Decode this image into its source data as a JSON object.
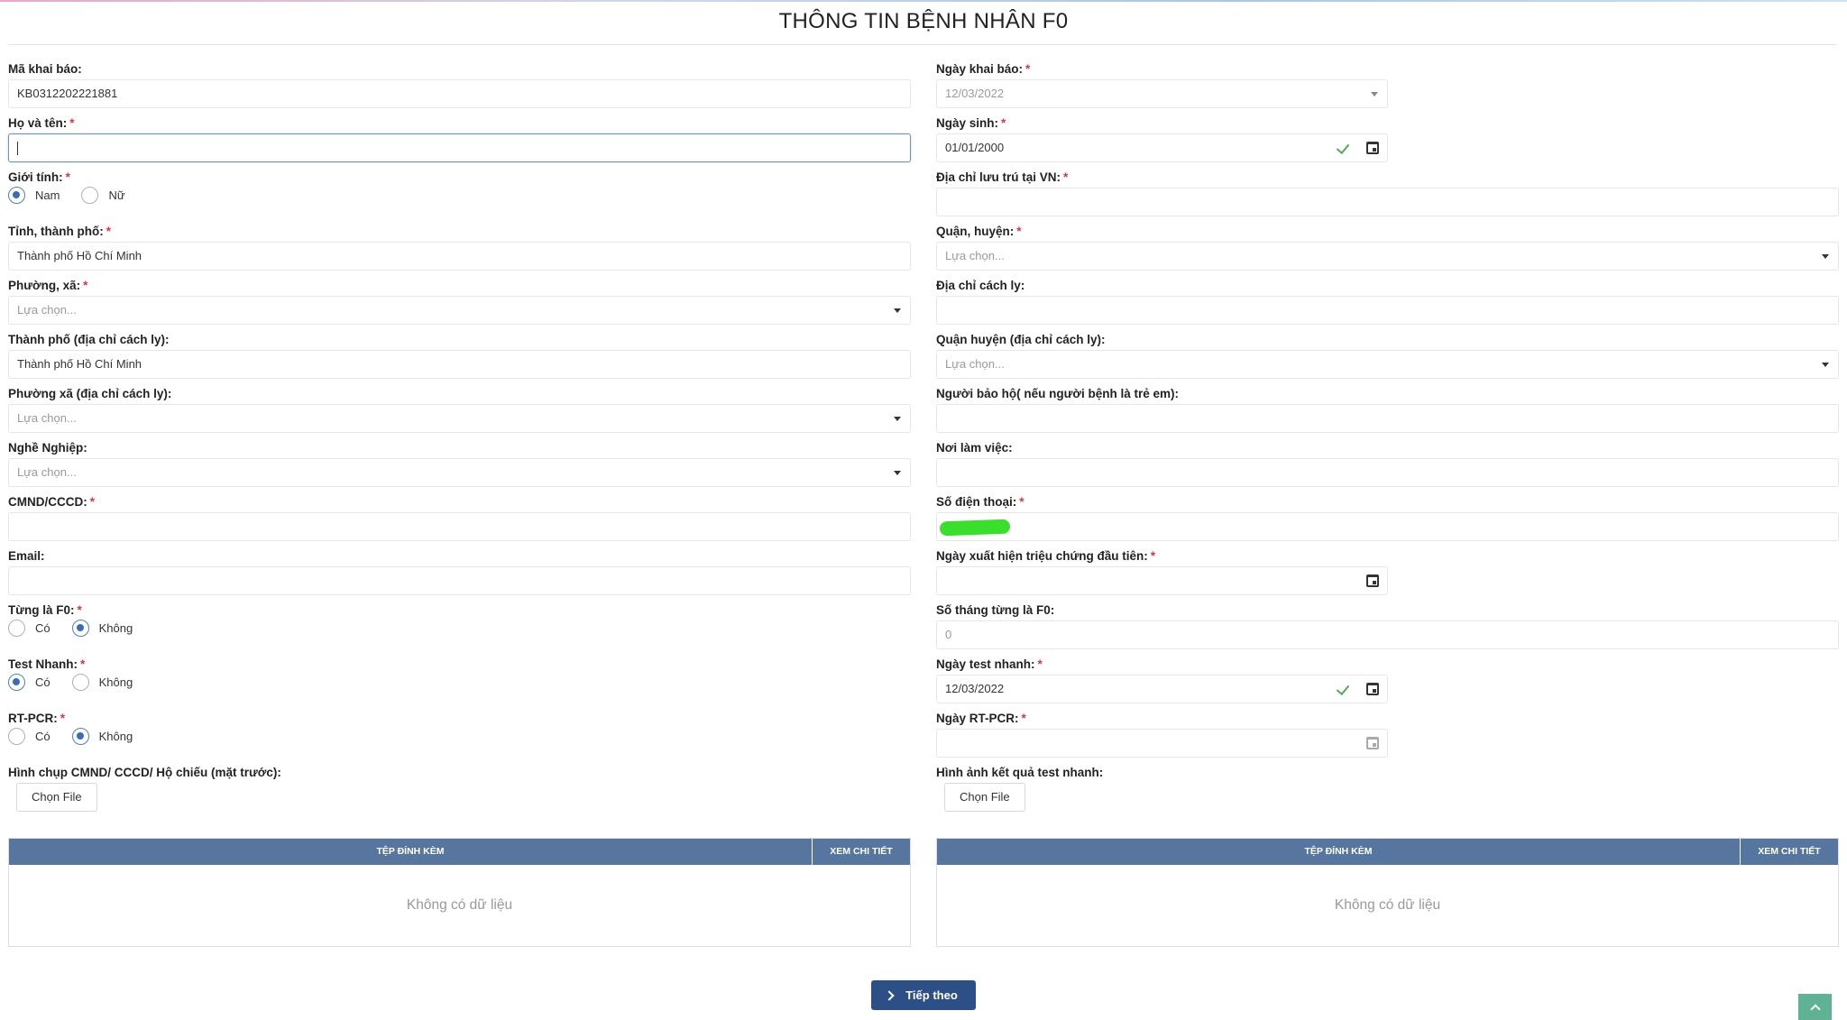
{
  "page": {
    "title": "THÔNG TIN BỆNH NHÂN F0"
  },
  "placeholder": "Lựa chọn...",
  "left": {
    "ma_khai_bao": {
      "label": "Mã khai báo:",
      "value": "KB0312202221881"
    },
    "ho_ten": {
      "label": "Họ và tên:",
      "value": ""
    },
    "gioi_tinh": {
      "label": "Giới tính:",
      "options": [
        "Nam",
        "Nữ"
      ],
      "selected": "Nam"
    },
    "tinh": {
      "label": "Tỉnh, thành phố:",
      "value": "Thành phố Hồ Chí Minh"
    },
    "phuong": {
      "label": "Phường, xã:"
    },
    "tp_cach_ly": {
      "label": "Thành phố (địa chỉ cách ly):",
      "value": "Thành phố Hồ Chí Minh"
    },
    "phuong_cach_ly": {
      "label": "Phường xã (địa chỉ cách ly):"
    },
    "nghe_nghiep": {
      "label": "Nghề Nghiệp:"
    },
    "cmnd": {
      "label": "CMND/CCCD:",
      "value": ""
    },
    "email": {
      "label": "Email:",
      "value": ""
    },
    "tung_f0": {
      "label": "Từng là F0:",
      "options": [
        "Có",
        "Không"
      ],
      "selected": "Không"
    },
    "test_nhanh": {
      "label": "Test Nhanh:",
      "options": [
        "Có",
        "Không"
      ],
      "selected": "Có"
    },
    "rt_pcr": {
      "label": "RT-PCR:",
      "options": [
        "Có",
        "Không"
      ],
      "selected": "Không"
    },
    "hinh_cmnd": {
      "label": "Hình chụp CMND/ CCCD/ Hộ chiếu (mặt trước):",
      "button": "Chọn File"
    }
  },
  "right": {
    "ngay_khai_bao": {
      "label": "Ngày khai báo:",
      "value": "12/03/2022"
    },
    "ngay_sinh": {
      "label": "Ngày sinh:",
      "value": "01/01/2000"
    },
    "dia_chi_vn": {
      "label": "Địa chỉ lưu trú tại VN:",
      "value": ""
    },
    "quan": {
      "label": "Quận, huyện:"
    },
    "dia_chi_cach_ly": {
      "label": "Địa chỉ cách ly:",
      "value": ""
    },
    "quan_cach_ly": {
      "label": "Quận huyện (địa chỉ cách ly):"
    },
    "nguoi_bao_ho": {
      "label": "Người bảo hộ( nếu người bệnh là trẻ em):",
      "value": ""
    },
    "noi_lam_viec": {
      "label": "Nơi làm việc:",
      "value": ""
    },
    "sdt": {
      "label": "Số điện thoại:"
    },
    "ngay_trieu_chung": {
      "label": "Ngày xuất hiện triệu chứng đầu tiên:",
      "value": ""
    },
    "so_thang_f0": {
      "label": "Số tháng từng là F0:",
      "value": "0"
    },
    "ngay_test_nhanh": {
      "label": "Ngày test nhanh:",
      "value": "12/03/2022"
    },
    "ngay_rt_pcr": {
      "label": "Ngày RT-PCR:",
      "value": ""
    },
    "hinh_test": {
      "label": "Hình ảnh kết quả test nhanh:",
      "button": "Chọn File"
    }
  },
  "table": {
    "col_file": "TỆP ĐÍNH KÈM",
    "col_detail": "XEM CHI TIẾT",
    "empty": "Không có dữ liệu"
  },
  "footer": {
    "next": "Tiếp theo"
  }
}
